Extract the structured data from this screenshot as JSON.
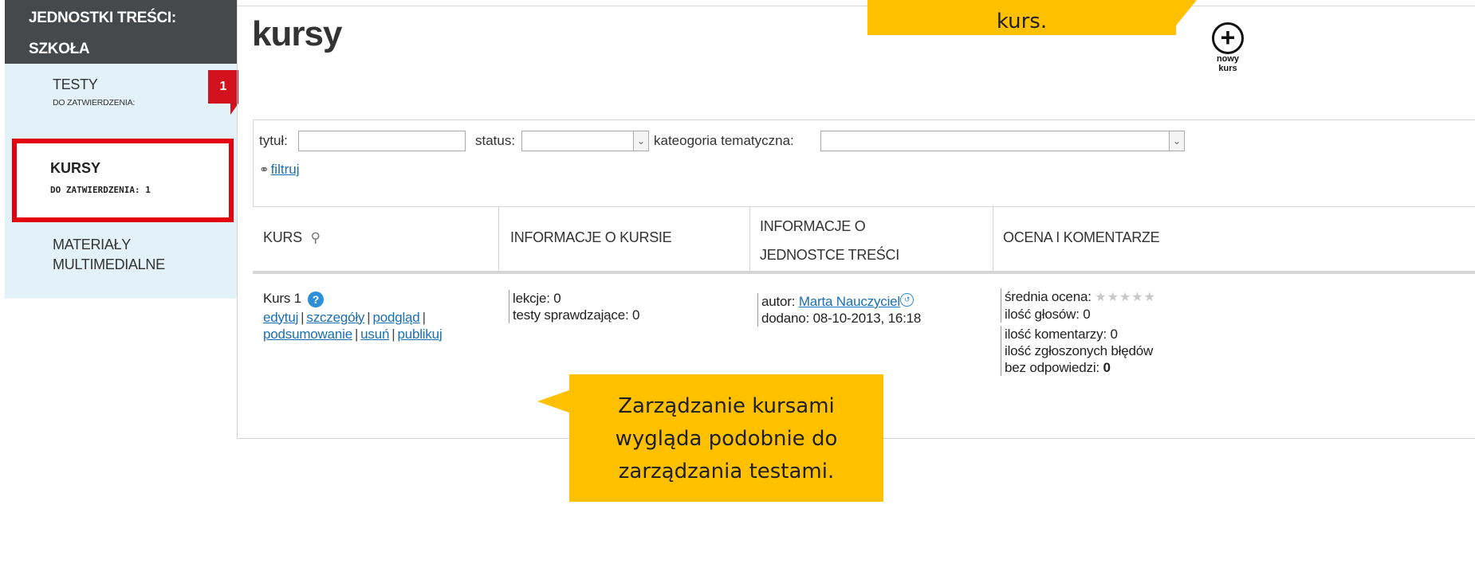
{
  "sidebar": {
    "header_line1": "JEDNOSTKI TREŚCI:",
    "header_line2": "SZKOŁA",
    "testy": {
      "title": "TESTY",
      "sub": "DO ZATWIERDZENIA:",
      "badge": "1"
    },
    "kursy": {
      "title": "KURSY",
      "sub": "DO ZATWIERDZENIA: 1"
    },
    "materialy": {
      "line1": "MATERIAŁY",
      "line2": "MULTIMEDIALNE"
    }
  },
  "page": {
    "title": "kursy",
    "new_course_line1": "nowy",
    "new_course_line2": "kurs"
  },
  "filters": {
    "title_label": "tytuł:",
    "status_label": "status:",
    "category_label": "kateogoria tematyczna:",
    "filter_link": "filtruj"
  },
  "table": {
    "headers": {
      "course": "KURS",
      "course_info": "INFORMACJE O KURSIE",
      "unit_info_line1": "INFORMACJE O",
      "unit_info_line2": "JEDNOSTCE TREŚCI",
      "rating": "OCENA I KOMENTARZE"
    },
    "row": {
      "name": "Kurs 1",
      "actions": {
        "edit": "edytuj",
        "details": "szczegóły",
        "preview": "podgląd",
        "summary": "podsumowanie",
        "delete": "usuń",
        "publish": "publikuj"
      },
      "lessons": "lekcje: 0",
      "tests": "testy sprawdzające: 0",
      "author_label": "autor:",
      "author_name": "Marta Nauczyciel",
      "added": "dodano: 08-10-2013, 16:18",
      "avg_rating_label": "średnia ocena:",
      "votes": "ilość głosów: 0",
      "comments": "ilość komentarzy: 0",
      "errors_line1": "ilość zgłoszonych błędów",
      "errors_line2_label": "bez odpowiedzi:",
      "errors_count": "0"
    }
  },
  "callouts": {
    "top_text": "kurs.",
    "bottom_line1": "Zarządzanie kursami",
    "bottom_line2": "wygląda podobnie do",
    "bottom_line3": "zarządzania testami."
  },
  "colors": {
    "sidebar_header": "#45494c",
    "sidebar_bg": "#e3f1f8",
    "highlight_red": "#e3000f",
    "callout_yellow": "#ffc000",
    "link_blue": "#1a6fb5"
  }
}
